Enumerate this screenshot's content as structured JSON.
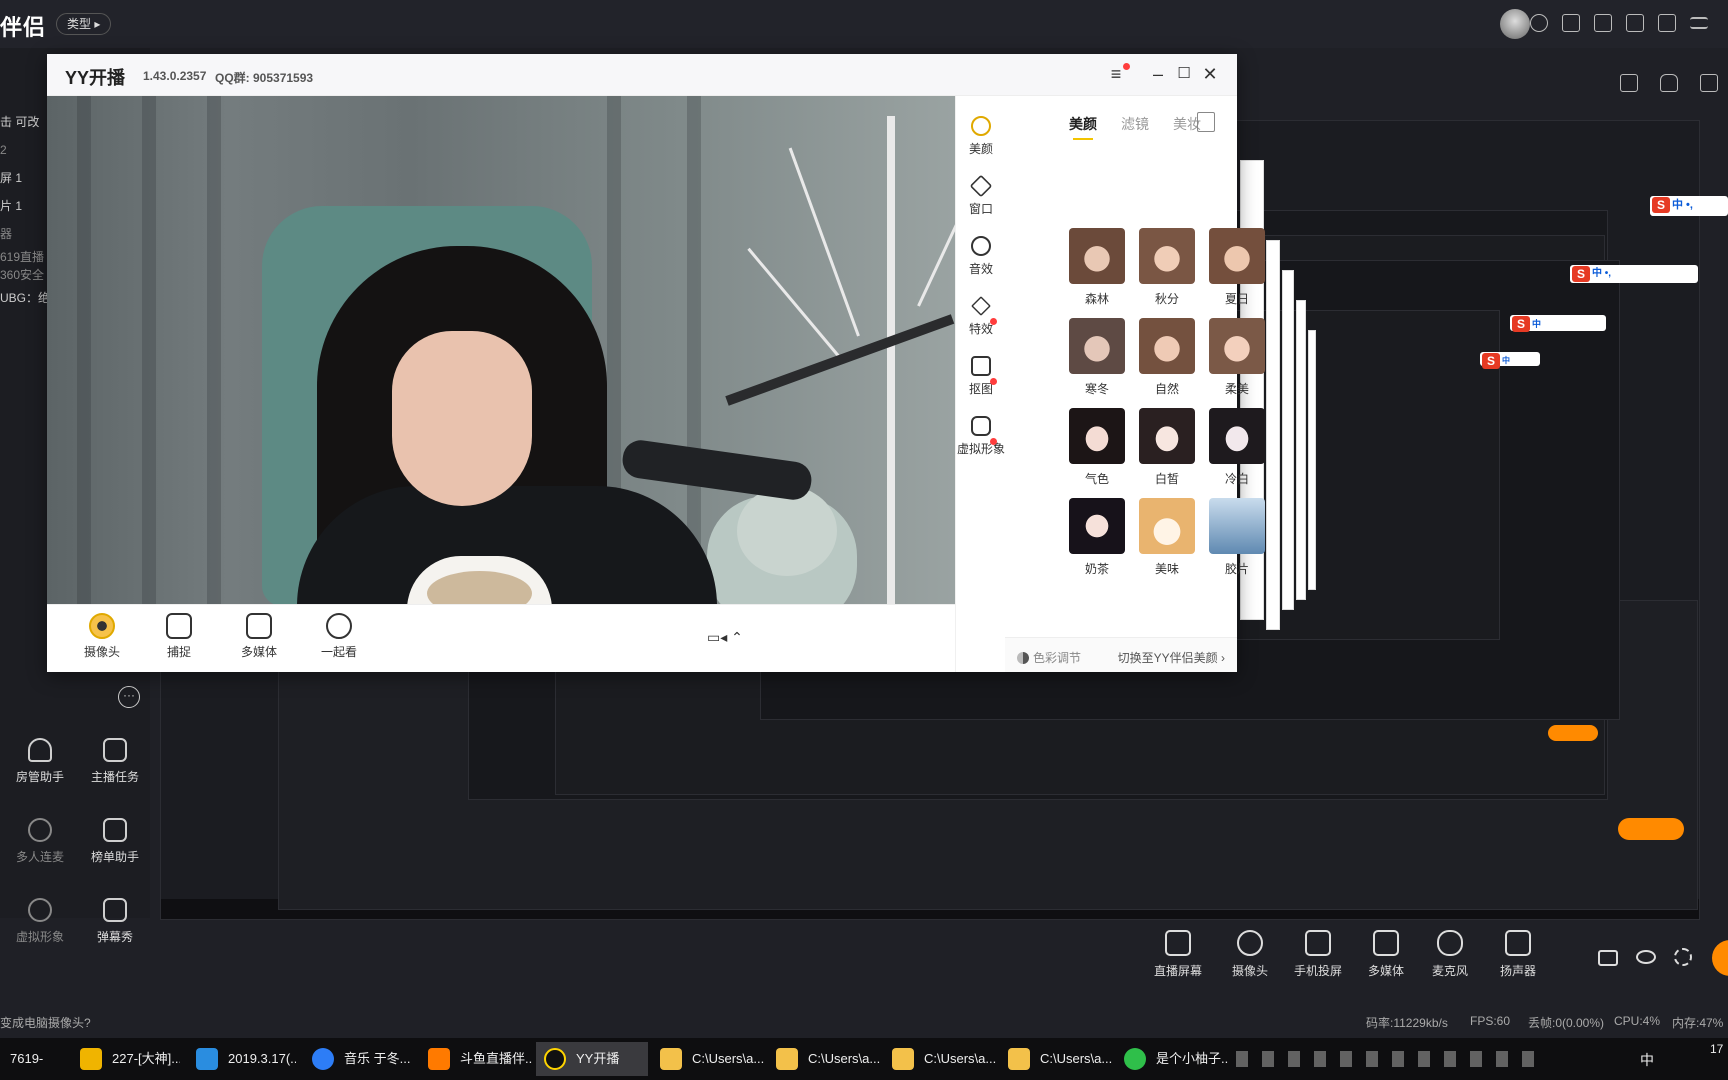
{
  "host": {
    "logo": "伴侣",
    "type_label": "类型",
    "side_list": [
      "击  可改",
      "2",
      "屏 1",
      "片 1",
      "器",
      "619直播",
      "360安全",
      "UBG：绝地"
    ],
    "tools": [
      {
        "label": "房管助手",
        "icon": "person-gear-icon"
      },
      {
        "label": "主播任务",
        "icon": "clipboard-check-icon"
      },
      {
        "label": "多人连麦",
        "icon": "download-icon"
      },
      {
        "label": "榜单助手",
        "icon": "star-box-icon"
      },
      {
        "label": "虚拟形象",
        "icon": "download-icon"
      },
      {
        "label": "弹幕秀",
        "icon": "tv-icon"
      }
    ],
    "bottom_tools": [
      {
        "label": "直播屏幕"
      },
      {
        "label": "摄像头"
      },
      {
        "label": "手机投屏"
      },
      {
        "label": "多媒体"
      },
      {
        "label": "麦克风"
      },
      {
        "label": "扬声器"
      }
    ],
    "status_prompt": "变成电脑摄像头?",
    "status": {
      "bitrate": "码率:11229kb/s",
      "fps": "FPS:60",
      "dropped": "丢帧:0(0.00%)",
      "cpu": "CPU:4%",
      "mem": "内存:47%"
    }
  },
  "taskbar": {
    "items": [
      {
        "label": "7619-",
        "color": "#2e6fd6"
      },
      {
        "label": "227-[大神]...",
        "color": "#f0b400"
      },
      {
        "label": "2019.3.17(...",
        "color": "#2a8de0"
      },
      {
        "label": "音乐 于冬...",
        "color": "#2d7df6"
      },
      {
        "label": "斗鱼直播伴...",
        "color": "#ff7a00"
      },
      {
        "label": "YY开播",
        "color": "#ffd400"
      },
      {
        "label": "C:\\Users\\a...",
        "color": "#f3c14a"
      },
      {
        "label": "C:\\Users\\a...",
        "color": "#f3c14a"
      },
      {
        "label": "C:\\Users\\a...",
        "color": "#f3c14a"
      },
      {
        "label": "C:\\Users\\a...",
        "color": "#f3c14a"
      },
      {
        "label": "是个小柚子...",
        "color": "#2fbf4a"
      }
    ],
    "tray_text": "中",
    "clock": "17"
  },
  "yy": {
    "title": "YY开播",
    "version": "1.43.0.2357",
    "qq": "QQ群: 905371593",
    "tools": [
      {
        "label": "摄像头"
      },
      {
        "label": "捕捉"
      },
      {
        "label": "多媒体"
      },
      {
        "label": "一起看"
      }
    ],
    "rail": [
      {
        "label": "美颜"
      },
      {
        "label": "窗口"
      },
      {
        "label": "音效"
      },
      {
        "label": "特效"
      },
      {
        "label": "抠图"
      },
      {
        "label": "虚拟形象"
      }
    ],
    "tabs": [
      "美颜",
      "滤镜",
      "美妆"
    ],
    "filters": [
      {
        "label": "森林",
        "tone": "#c9a48f"
      },
      {
        "label": "秋分",
        "tone": "#d4a98c"
      },
      {
        "label": "夏日",
        "tone": "#caa08a"
      },
      {
        "label": "寒冬",
        "tone": "#b9a59c"
      },
      {
        "label": "自然",
        "tone": "#c7a18e"
      },
      {
        "label": "柔美",
        "tone": "#d3ab98"
      },
      {
        "label": "气色",
        "tone": "#e7d6d0"
      },
      {
        "label": "白皙",
        "tone": "#efe3df"
      },
      {
        "label": "冷白",
        "tone": "#e6e3e8"
      },
      {
        "label": "奶茶",
        "tone": "#e8dcd6"
      },
      {
        "label": "美味",
        "tone": "#e9b46f"
      },
      {
        "label": "胶片",
        "tone": "#7fa3c3"
      }
    ],
    "footer_left": "色彩调节",
    "footer_right": "切换至YY伴侣美颜 ›"
  }
}
